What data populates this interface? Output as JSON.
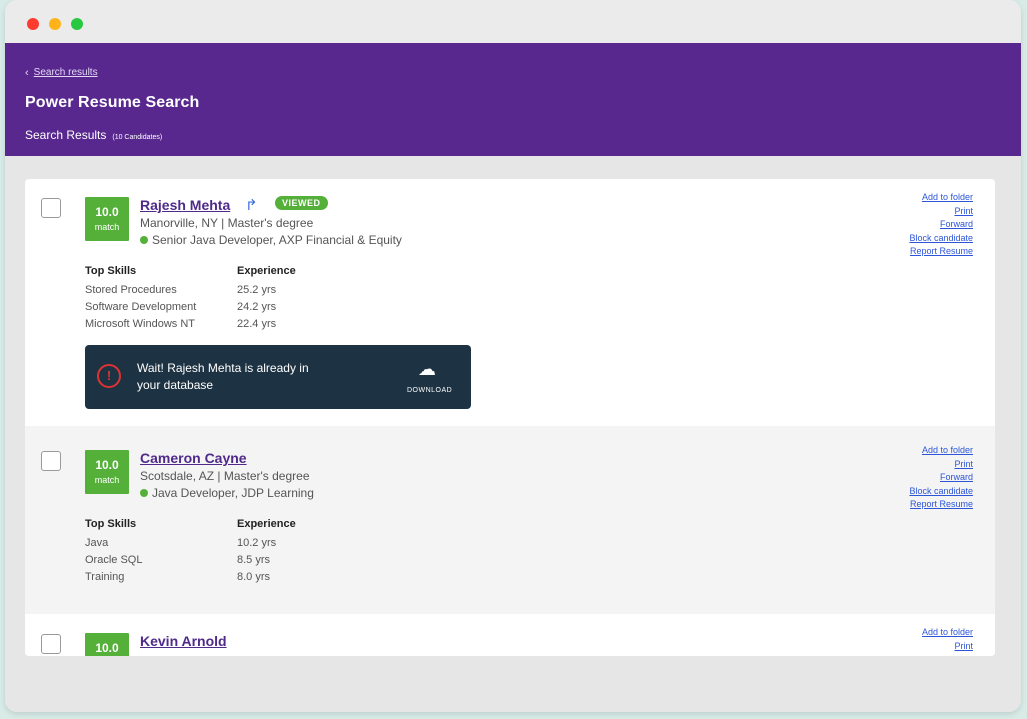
{
  "header": {
    "back_link": "Search results",
    "title": "Power Resume Search",
    "results_label": "Search Results",
    "results_count": "(10 Candidates)"
  },
  "colors": {
    "header_bg": "#58288f",
    "match_green": "#55b03a",
    "banner_bg": "#1d3242",
    "link_blue": "#2c55d8"
  },
  "actions": [
    "Add to folder",
    "Print",
    "Forward",
    "Block candidate",
    "Report Resume"
  ],
  "skills_headers": {
    "skills": "Top Skills",
    "experience": "Experience"
  },
  "candidates": [
    {
      "score": "10.0",
      "match_label": "match",
      "name": "Rajesh Mehta",
      "badge": "VIEWED",
      "location": "Manorville, NY | Master's degree",
      "job": "Senior Java Developer, AXP Financial & Equity",
      "skills": [
        {
          "name": "Stored Procedures",
          "exp": "25.2 yrs"
        },
        {
          "name": "Software Development",
          "exp": "24.2 yrs"
        },
        {
          "name": "Microsoft Windows NT",
          "exp": "22.4 yrs"
        }
      ],
      "banner": {
        "message": "Wait! Rajesh Mehta is already in your database",
        "download_label": "DOWNLOAD"
      }
    },
    {
      "score": "10.0",
      "match_label": "match",
      "name": "Cameron Cayne",
      "location": "Scotsdale, AZ | Master's degree",
      "job": "Java Developer, JDP Learning",
      "skills": [
        {
          "name": "Java",
          "exp": "10.2 yrs"
        },
        {
          "name": "Oracle SQL",
          "exp": "8.5 yrs"
        },
        {
          "name": "Training",
          "exp": "8.0 yrs"
        }
      ]
    },
    {
      "score": "10.0",
      "name": "Kevin Arnold"
    }
  ]
}
